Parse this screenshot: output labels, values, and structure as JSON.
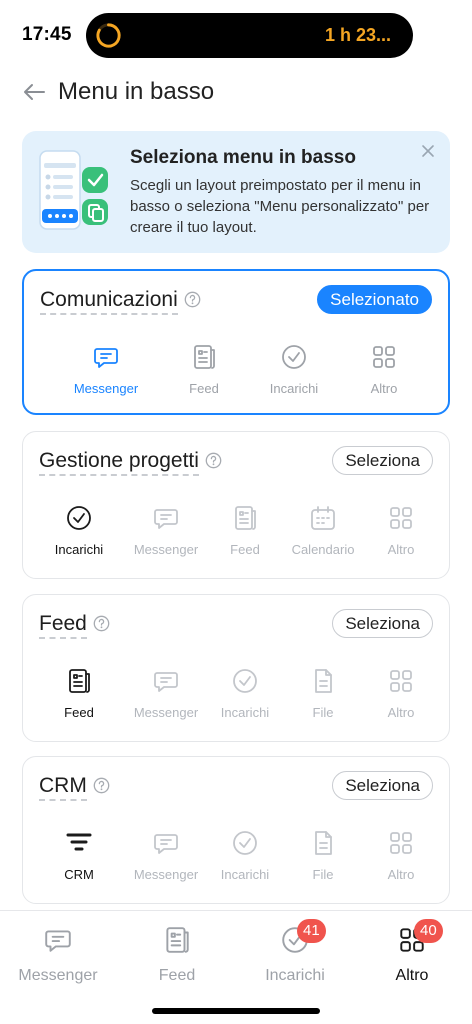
{
  "status_bar": {
    "time": "17:45",
    "activity_timer": "1 h 23..."
  },
  "header": {
    "title": "Menu in basso"
  },
  "banner": {
    "title": "Seleziona menu in basso",
    "text": "Scegli un layout preimpostato per il menu in basso o seleziona \"Menu personalizzato\" per creare il tuo layout."
  },
  "cards": [
    {
      "title": "Comunicazioni",
      "button": "Selezionato",
      "selected": true,
      "tabs": [
        {
          "label": "Messenger",
          "icon": "chat-icon"
        },
        {
          "label": "Feed",
          "icon": "feed-icon"
        },
        {
          "label": "Incarichi",
          "icon": "check-circle-icon"
        },
        {
          "label": "Altro",
          "icon": "grid-icon"
        }
      ]
    },
    {
      "title": "Gestione progetti",
      "button": "Seleziona",
      "selected": false,
      "tabs": [
        {
          "label": "Incarichi",
          "icon": "check-circle-icon"
        },
        {
          "label": "Messenger",
          "icon": "chat-icon"
        },
        {
          "label": "Feed",
          "icon": "feed-icon"
        },
        {
          "label": "Calendario",
          "icon": "calendar-icon"
        },
        {
          "label": "Altro",
          "icon": "grid-icon"
        }
      ]
    },
    {
      "title": "Feed",
      "button": "Seleziona",
      "selected": false,
      "tabs": [
        {
          "label": "Feed",
          "icon": "feed-icon"
        },
        {
          "label": "Messenger",
          "icon": "chat-icon"
        },
        {
          "label": "Incarichi",
          "icon": "check-circle-icon"
        },
        {
          "label": "File",
          "icon": "file-icon"
        },
        {
          "label": "Altro",
          "icon": "grid-icon"
        }
      ]
    },
    {
      "title": "CRM",
      "button": "Seleziona",
      "selected": false,
      "tabs": [
        {
          "label": "CRM",
          "icon": "funnel-icon"
        },
        {
          "label": "Messenger",
          "icon": "chat-icon"
        },
        {
          "label": "Incarichi",
          "icon": "check-circle-icon"
        },
        {
          "label": "File",
          "icon": "file-icon"
        },
        {
          "label": "Altro",
          "icon": "grid-icon"
        }
      ]
    }
  ],
  "bottom_nav": [
    {
      "label": "Messenger",
      "icon": "chat-icon",
      "badge": ""
    },
    {
      "label": "Feed",
      "icon": "feed-icon",
      "badge": ""
    },
    {
      "label": "Incarichi",
      "icon": "check-circle-icon",
      "badge": "41"
    },
    {
      "label": "Altro",
      "icon": "grid-icon",
      "badge": "40",
      "active": true
    }
  ],
  "colors": {
    "accent": "#1a84ff",
    "badge": "#f0544d",
    "banner_bg": "#e3f1fc",
    "timer": "#f5a623"
  }
}
